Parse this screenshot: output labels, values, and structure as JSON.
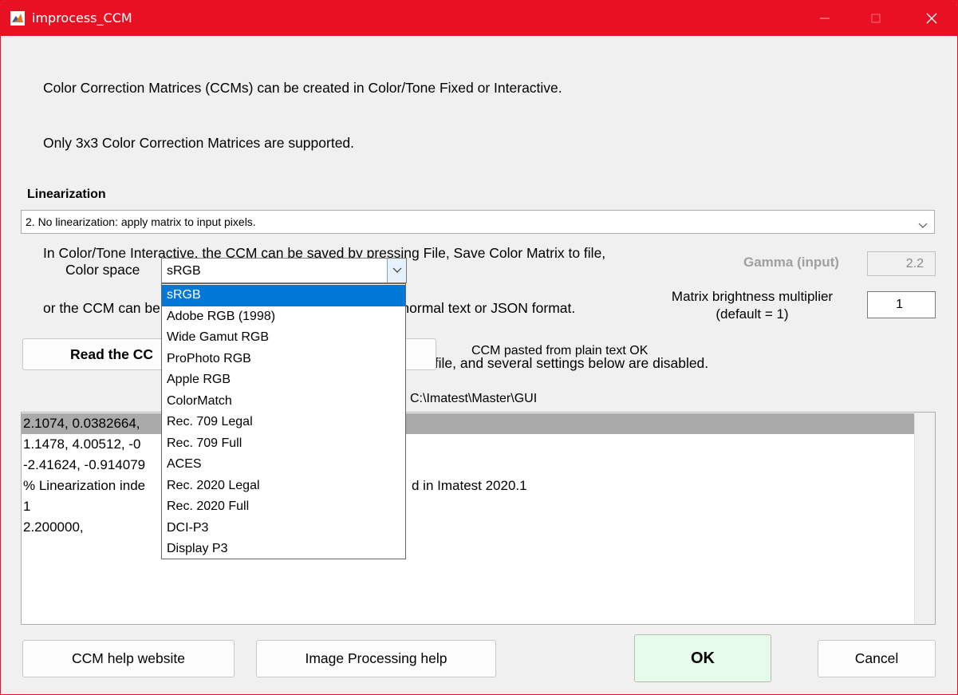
{
  "window": {
    "title": "improcess_CCM",
    "icon": "matlab-icon",
    "controls": [
      "minimize-icon",
      "maximize-icon",
      "close-icon"
    ],
    "accent_color": "#e81123"
  },
  "info_lines": [
    "Color Correction Matrices (CCMs) can be created in Color/Tone Fixed or Interactive.",
    "Only 3x3 Color Correction Matrices are supported.",
    "",
    "In Color/Tone Interactive, the CCM can be saved by pressing File, Save Color Matrix to file,",
    "or the CCM can be copied to the clipboard (for pasting) in normal text or JSON format.",
    "In Imatest R2020.1+, Linearization data is included in the CCM file, and several settings below are disabled."
  ],
  "linearization": {
    "label": "Linearization",
    "selected": "2.  No linearization: apply matrix to input pixels."
  },
  "color_space": {
    "label": "Color space",
    "selected": "sRGB",
    "options": [
      "sRGB",
      "Adobe RGB (1998)",
      "Wide Gamut RGB",
      "ProPhoto RGB",
      "Apple RGB",
      "ColorMatch",
      "Rec. 709 Legal",
      "Rec. 709 Full",
      "ACES",
      "Rec. 2020 Legal",
      "Rec. 2020 Full",
      "DCI-P3",
      "Display P3"
    ],
    "highlight_color": "#0078d7"
  },
  "gamma": {
    "label": "Gamma (input)",
    "value": "2.2"
  },
  "multiplier": {
    "label_line1": "Matrix brightness multiplier",
    "label_line2": "(default = 1)",
    "value": "1"
  },
  "read_button_visible": "Read the CC",
  "status_text": "CCM pasted from plain text OK",
  "path_text": "C:\\Imatest\\Master\\GUI",
  "textarea_lines": [
    "2.1074, 0.0382664,",
    "1.1478, 4.00512, -0",
    "-2.41624, -0.914079",
    "% Linearization inde",
    "1",
    "2.200000,"
  ],
  "textarea_tail_line4": "d in Imatest 2020.1",
  "buttons": {
    "help": "CCM help website",
    "imgproc": "Image Processing help",
    "ok": "OK",
    "cancel": "Cancel"
  }
}
